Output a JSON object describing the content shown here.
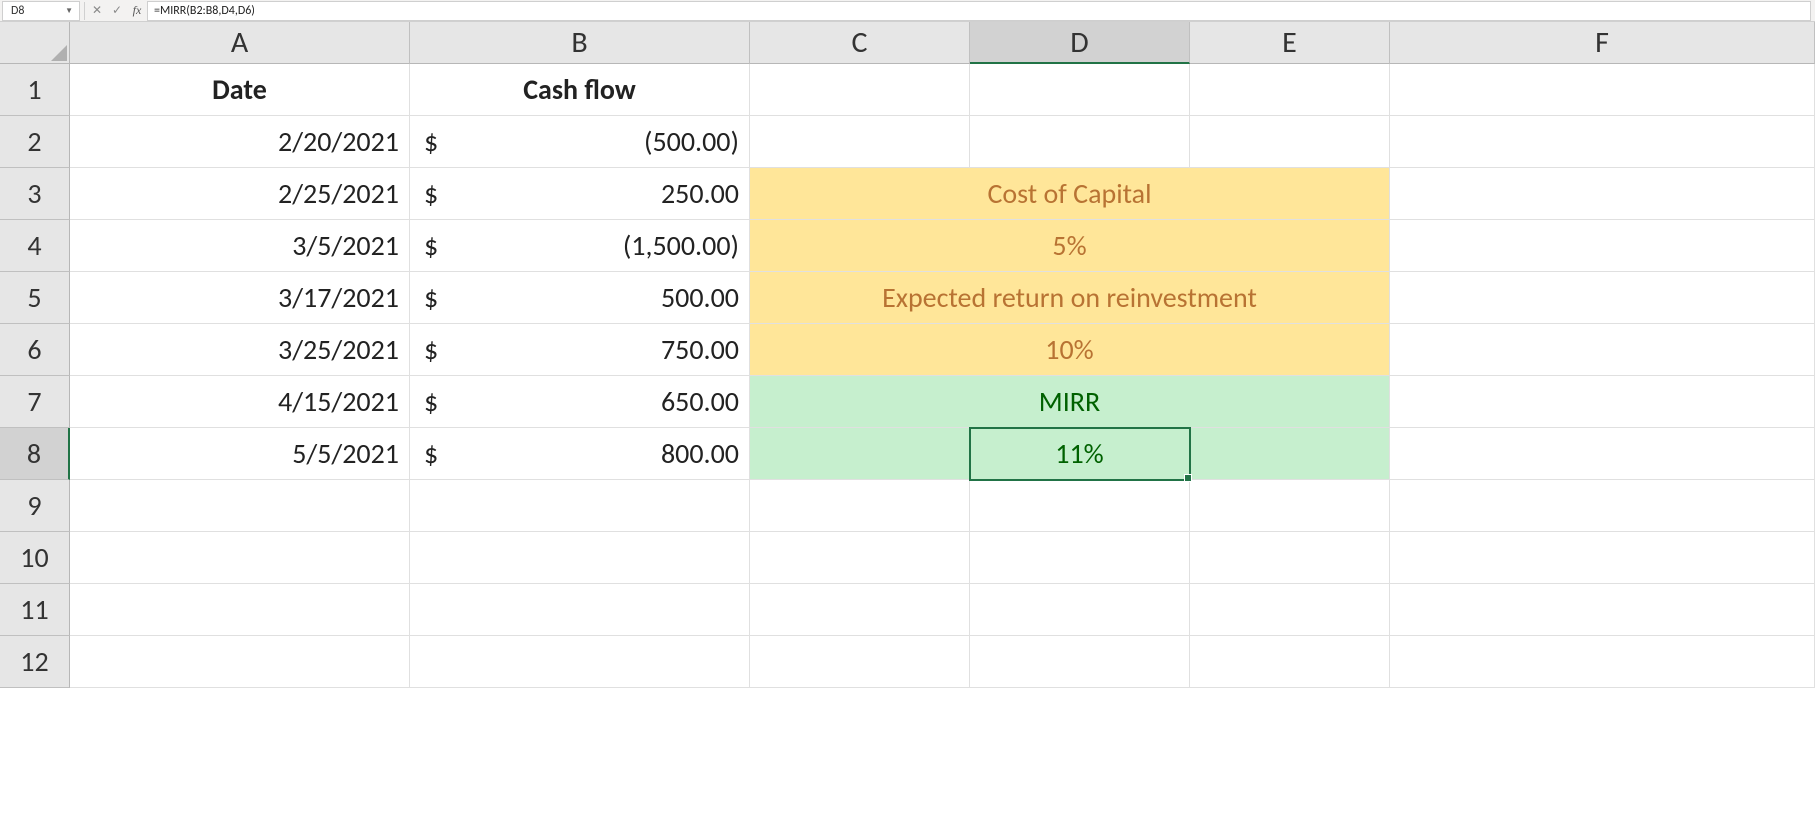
{
  "formula_bar": {
    "name_box": "D8",
    "formula": "=MIRR(B2:B8,D4,D6)"
  },
  "columns": [
    "A",
    "B",
    "C",
    "D",
    "E",
    "F"
  ],
  "rows": [
    "1",
    "2",
    "3",
    "4",
    "5",
    "6",
    "7",
    "8",
    "9",
    "10",
    "11",
    "12"
  ],
  "headers": {
    "A1": "Date",
    "B1": "Cash flow"
  },
  "data": {
    "dates": [
      "2/20/2021",
      "2/25/2021",
      "3/5/2021",
      "3/17/2021",
      "3/25/2021",
      "4/15/2021",
      "5/5/2021"
    ],
    "cashflow": [
      "(500.00)",
      "250.00",
      "(1,500.00)",
      "500.00",
      "750.00",
      "650.00",
      "800.00"
    ],
    "currency_symbol": "$"
  },
  "panel": {
    "cost_label": "Cost of Capital",
    "cost_value": "5%",
    "reinvest_label": "Expected return on reinvestment",
    "reinvest_value": "10%",
    "mirr_label": "MIRR",
    "mirr_value": "11%"
  },
  "active_cell": "D8"
}
